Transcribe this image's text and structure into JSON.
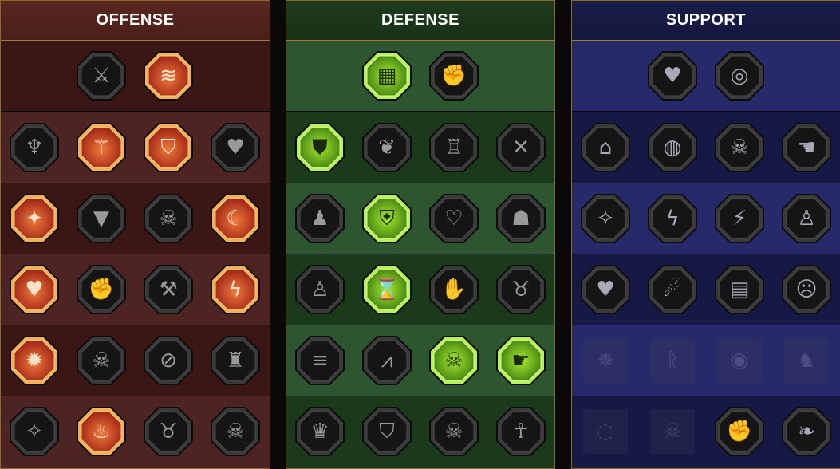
{
  "panels": [
    {
      "id": "offense",
      "title": "OFFENSE",
      "rows": [
        [
          {
            "icon": "crossed-swords-icon",
            "state": "locked"
          },
          {
            "icon": "triple-claw-slash-icon",
            "state": "unlocked"
          }
        ],
        [
          {
            "icon": "horned-demon-icon",
            "state": "locked"
          },
          {
            "icon": "sword-slash-icon",
            "state": "unlocked"
          },
          {
            "icon": "broken-shield-icon",
            "state": "unlocked"
          },
          {
            "icon": "spiked-heart-icon",
            "state": "locked"
          }
        ],
        [
          {
            "icon": "pierced-figure-icon",
            "state": "unlocked"
          },
          {
            "icon": "fanged-maw-icon",
            "state": "locked"
          },
          {
            "icon": "skull-wind-icon",
            "state": "locked"
          },
          {
            "icon": "reaper-hand-icon",
            "state": "unlocked"
          }
        ],
        [
          {
            "icon": "bleeding-heart-sword-icon",
            "state": "unlocked"
          },
          {
            "icon": "gauntlet-fist-icon",
            "state": "locked"
          },
          {
            "icon": "battle-axe-icon",
            "state": "locked"
          },
          {
            "icon": "lightning-chain-icon",
            "state": "unlocked"
          }
        ],
        [
          {
            "icon": "arrow-burst-icon",
            "state": "unlocked"
          },
          {
            "icon": "triple-skull-icon",
            "state": "locked"
          },
          {
            "icon": "sword-circle-icon",
            "state": "locked"
          },
          {
            "icon": "enraged-warrior-icon",
            "state": "locked"
          }
        ],
        [
          {
            "icon": "sparkling-sword-icon",
            "state": "locked"
          },
          {
            "icon": "flaming-helmet-icon",
            "state": "unlocked"
          },
          {
            "icon": "horned-beast-icon",
            "state": "locked"
          },
          {
            "icon": "skull-helmet-icon",
            "state": "locked"
          }
        ]
      ]
    },
    {
      "id": "defense",
      "title": "DEFENSE",
      "rows": [
        [
          {
            "icon": "scale-armor-icon",
            "state": "unlocked"
          },
          {
            "icon": "raised-fist-icon",
            "state": "locked"
          }
        ],
        [
          {
            "icon": "chevron-shield-icon",
            "state": "unlocked"
          },
          {
            "icon": "heart-organ-icon",
            "state": "locked"
          },
          {
            "icon": "stone-golem-icon",
            "state": "locked"
          },
          {
            "icon": "crossed-blades-icon",
            "state": "locked"
          }
        ],
        [
          {
            "icon": "dodge-figure-icon",
            "state": "locked"
          },
          {
            "icon": "knight-shield-icon",
            "state": "unlocked"
          },
          {
            "icon": "skull-heart-icon",
            "state": "locked"
          },
          {
            "icon": "hooded-figure-icon",
            "state": "locked"
          }
        ],
        [
          {
            "icon": "group-silhouette-icon",
            "state": "locked"
          },
          {
            "icon": "hourglass-radiant-icon",
            "state": "unlocked"
          },
          {
            "icon": "open-palm-icon",
            "state": "locked"
          },
          {
            "icon": "bull-head-icon",
            "state": "locked"
          }
        ],
        [
          {
            "icon": "dash-figure-icon",
            "state": "locked"
          },
          {
            "icon": "claw-marks-icon",
            "state": "locked"
          },
          {
            "icon": "radiant-skull-icon",
            "state": "unlocked"
          },
          {
            "icon": "reaching-hand-icon",
            "state": "unlocked"
          }
        ],
        [
          {
            "icon": "berserker-icon",
            "state": "locked"
          },
          {
            "icon": "winged-shield-icon",
            "state": "locked"
          },
          {
            "icon": "skull-rider-icon",
            "state": "locked"
          },
          {
            "icon": "monk-figure-icon",
            "state": "locked"
          }
        ]
      ]
    },
    {
      "id": "support",
      "title": "SUPPORT",
      "rows": [
        [
          {
            "icon": "heart-plus-icon",
            "state": "available"
          },
          {
            "icon": "target-rays-icon",
            "state": "available"
          }
        ],
        [
          {
            "icon": "praying-hands-icon",
            "state": "available"
          },
          {
            "icon": "shield-aura-icon",
            "state": "available"
          },
          {
            "icon": "flaming-skull-icon",
            "state": "available"
          },
          {
            "icon": "swift-hand-icon",
            "state": "available"
          }
        ],
        [
          {
            "icon": "sparkle-figure-icon",
            "state": "available"
          },
          {
            "icon": "lightning-bolt-icon",
            "state": "available"
          },
          {
            "icon": "crackle-icon",
            "state": "available"
          },
          {
            "icon": "twin-figures-icon",
            "state": "available"
          }
        ],
        [
          {
            "icon": "heart-chain-icon",
            "state": "available"
          },
          {
            "icon": "comet-icon",
            "state": "available"
          },
          {
            "icon": "open-book-icon",
            "state": "available"
          },
          {
            "icon": "furious-face-icon",
            "state": "available"
          }
        ],
        [
          {
            "icon": "compass-star-icon",
            "state": "disabled"
          },
          {
            "icon": "rune-blade-icon",
            "state": "disabled"
          },
          {
            "icon": "all-seeing-eye-icon",
            "state": "disabled"
          },
          {
            "icon": "fighter-pose-icon",
            "state": "disabled"
          }
        ],
        [
          {
            "icon": "spiral-orb-icon",
            "state": "disabled"
          },
          {
            "icon": "skull-crest-icon",
            "state": "disabled"
          },
          {
            "icon": "fist-burst-icon",
            "state": "available"
          },
          {
            "icon": "eagle-head-icon",
            "state": "available"
          }
        ]
      ]
    }
  ],
  "colors": {
    "offense_active": "#e8643a",
    "defense_active": "#7dd21e",
    "locked_frame": "#2b2b2b",
    "header_rule": "#a07a35"
  }
}
